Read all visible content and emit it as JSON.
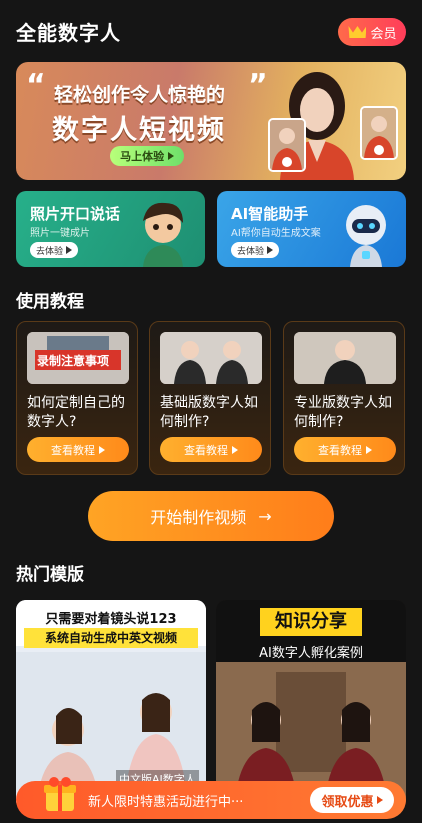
{
  "header": {
    "title": "全能数字人",
    "vip_label": "会员"
  },
  "hero": {
    "line1": "轻松创作令人惊艳的",
    "line2": "数字人短视频",
    "button": "马上体验"
  },
  "feature_cards": [
    {
      "title": "照片开口说话",
      "subtitle": "照片一键成片",
      "button": "去体验"
    },
    {
      "title": "AI智能助手",
      "subtitle": "AI帮你自动生成文案",
      "button": "去体验"
    }
  ],
  "tutorials": {
    "section_title": "使用教程",
    "items": [
      {
        "title": "如何定制自己的数字人?",
        "thumb_text": "录制注意事项",
        "button": "查看教程"
      },
      {
        "title": "基础版数字人如何制作?",
        "button": "查看教程"
      },
      {
        "title": "专业版数字人如何制作?",
        "button": "查看教程"
      }
    ]
  },
  "main_button": {
    "label": "开始制作视频",
    "arrow": "→"
  },
  "templates": {
    "section_title": "热门模版",
    "items": [
      {
        "headline": "只需要对着镜头说123",
        "sub": "系统自动生成中英文视频",
        "caption": "中文版AI数字人"
      },
      {
        "headline": "知识分享",
        "sub": "AI数字人孵化案例"
      }
    ]
  },
  "promo": {
    "text": "新人限时特惠活动进行中···",
    "button": "领取优惠"
  },
  "colors": {
    "accent": "#ff8a1a",
    "vip": "#ff3d5a",
    "bg": "#151515"
  }
}
